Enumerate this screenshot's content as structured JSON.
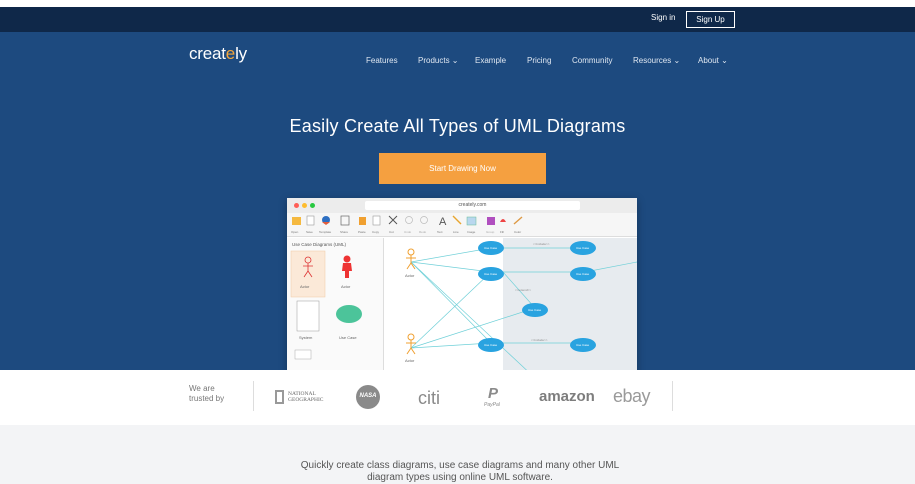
{
  "topbar": {
    "sign_in": "Sign in",
    "sign_up": "Sign Up"
  },
  "brand": {
    "logo_prefix": "creat",
    "logo_dot": "e",
    "logo_suffix": "ly"
  },
  "nav": {
    "features": "Features",
    "products": "Products ⌄",
    "example": "Example",
    "pricing": "Pricing",
    "community": "Community",
    "resources": "Resources ⌄",
    "about": "About ⌄"
  },
  "hero": {
    "headline": "Easily Create All Types of UML Diagrams",
    "cta": "Start Drawing Now"
  },
  "app": {
    "url": "creately.com",
    "panel_title": "Use Case Diagrams (UML)",
    "toolbar_labels": [
      "Open",
      "Save",
      "Template",
      "Share",
      "Paste",
      "Copy",
      "Cut",
      "Undo",
      "Redo",
      "Text",
      "Line",
      "Image",
      "Group",
      "Fill",
      "Color"
    ],
    "shape_labels": {
      "actor1": "Actor",
      "actor2": "Actor",
      "system": "System",
      "usecase": "Use Case"
    },
    "canvas_labels": {
      "actor_top": "Actor",
      "actor_bottom": "Actor",
      "node1": "Use Case",
      "node2": "Use Case",
      "node3": "Use Case",
      "node4": "Use Case",
      "node5": "Use Case",
      "node6": "Use Case",
      "node7": "Use Case",
      "note1": "<<include>>",
      "note2": "<<extend>>",
      "note3": "<<include>>"
    }
  },
  "trust": {
    "label_line1": "We are",
    "label_line2": "trusted by",
    "logos": {
      "natgeo_line1": "NATIONAL",
      "natgeo_line2": "GEOGRAPHIC",
      "nasa": "NASA",
      "citi": "citi",
      "paypal": "PayPal",
      "amazon": "amazon",
      "ebay": "ebay"
    }
  },
  "bottom": {
    "line1": "Quickly create class diagrams, use case diagrams and many other UML",
    "line2": "diagram types using online UML software."
  },
  "colors": {
    "accent": "#f5a040",
    "hero_bg": "#1d4a7f",
    "topbar_bg": "#0f2849"
  }
}
